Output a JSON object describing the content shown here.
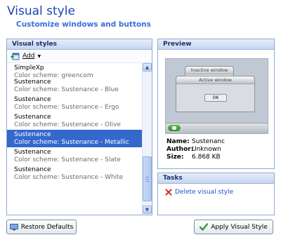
{
  "header": {
    "title": "Visual style",
    "subtitle": "Customize windows and buttons"
  },
  "styles_panel": {
    "header": "Visual styles",
    "toolbar": {
      "add_label": "Add"
    },
    "items": [
      {
        "name": "SimpleXp",
        "scheme": "Color scheme: greencom",
        "selected": false
      },
      {
        "name": "Sustenance",
        "scheme": "Color scheme: Sustenance - Blue",
        "selected": false
      },
      {
        "name": "Sustenance",
        "scheme": "Color scheme: Sustenance - Ergo",
        "selected": false
      },
      {
        "name": "Sustenance",
        "scheme": "Color scheme: Sustenance - Olive",
        "selected": false
      },
      {
        "name": "Sustenance",
        "scheme": "Color scheme: Sustenance - Metallic",
        "selected": true
      },
      {
        "name": "Sustenance",
        "scheme": "Color scheme: Sustenance - Slate",
        "selected": false
      },
      {
        "name": "Sustenance",
        "scheme": "Color scheme: Sustenance - White",
        "selected": false
      }
    ]
  },
  "preview_panel": {
    "header": "Preview",
    "mock": {
      "inactive_window_title": "Inactive window",
      "active_window_title": "Active window",
      "ok_label": "OK"
    },
    "info": {
      "name_label": "Name:",
      "name_value": "Sustenanc",
      "author_label": "Author:",
      "author_value": "Unknown",
      "size_label": "Size:",
      "size_value": "6.868 KB"
    }
  },
  "tasks_panel": {
    "header": "Tasks",
    "delete_label": "Delete visual style"
  },
  "buttons": {
    "restore_label": "Restore Defaults",
    "apply_label": "Apply Visual Style"
  }
}
